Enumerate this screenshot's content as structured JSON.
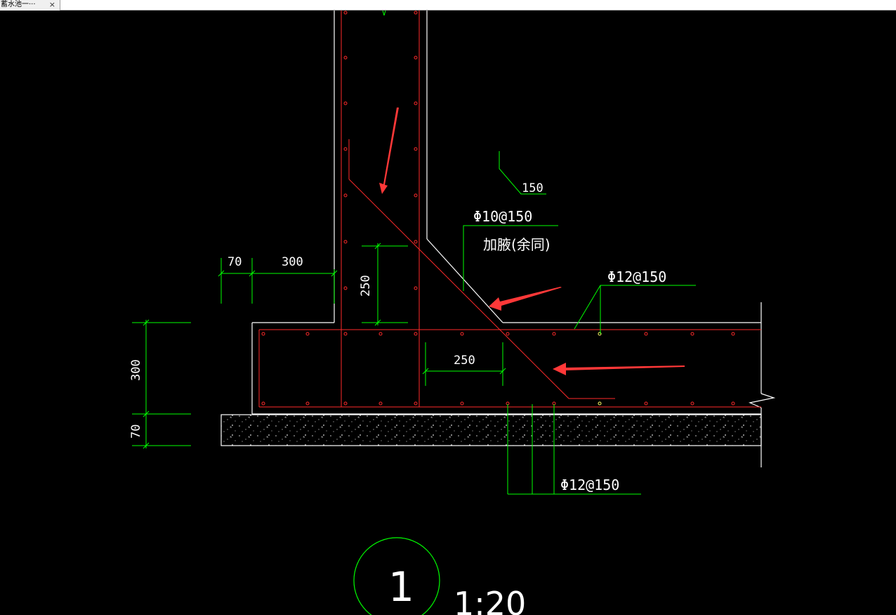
{
  "tab": {
    "title": "蓄水池一···",
    "close_glyph": "×"
  },
  "drawing": {
    "dimensions": {
      "d70_top": "70",
      "d300_top": "300",
      "d250_vertical": "250",
      "d250_horizontal": "250",
      "d300_left": "300",
      "d70_left": "70",
      "d150": "150"
    },
    "labels": {
      "rebar_wall": "Φ10@150",
      "haunch_note": "加腋(余同)",
      "rebar_top_slab": "Φ12@150",
      "rebar_bottom_slab": "Φ12@150"
    },
    "section": {
      "number": "1",
      "scale": "1:20"
    },
    "colors": {
      "background": "#000000",
      "concrete_outline": "#ffffff",
      "rebar": "#ff2a2a",
      "dimension": "#00ff00",
      "arrow": "#ff3838"
    }
  }
}
